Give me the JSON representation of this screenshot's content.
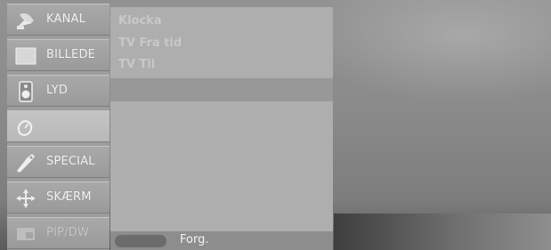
{
  "sidebar": {
    "items": [
      {
        "label": "KANAL",
        "icon": "satellite-dish-icon"
      },
      {
        "label": "BILLEDE",
        "icon": "picture-icon"
      },
      {
        "label": "LYD",
        "icon": "speaker-icon"
      },
      {
        "label": "",
        "icon": "clock-icon"
      },
      {
        "label": "SPECIAL",
        "icon": "tag-icon"
      },
      {
        "label": "SKÆRM",
        "icon": "screen-arrows-icon"
      },
      {
        "label": "PIP/DW",
        "icon": "pip-icon"
      }
    ],
    "selected_index": 3
  },
  "submenu": {
    "items": [
      "Klocka",
      "TV Fra tid",
      "TV Til"
    ]
  },
  "footer": {
    "label": "Forg."
  }
}
